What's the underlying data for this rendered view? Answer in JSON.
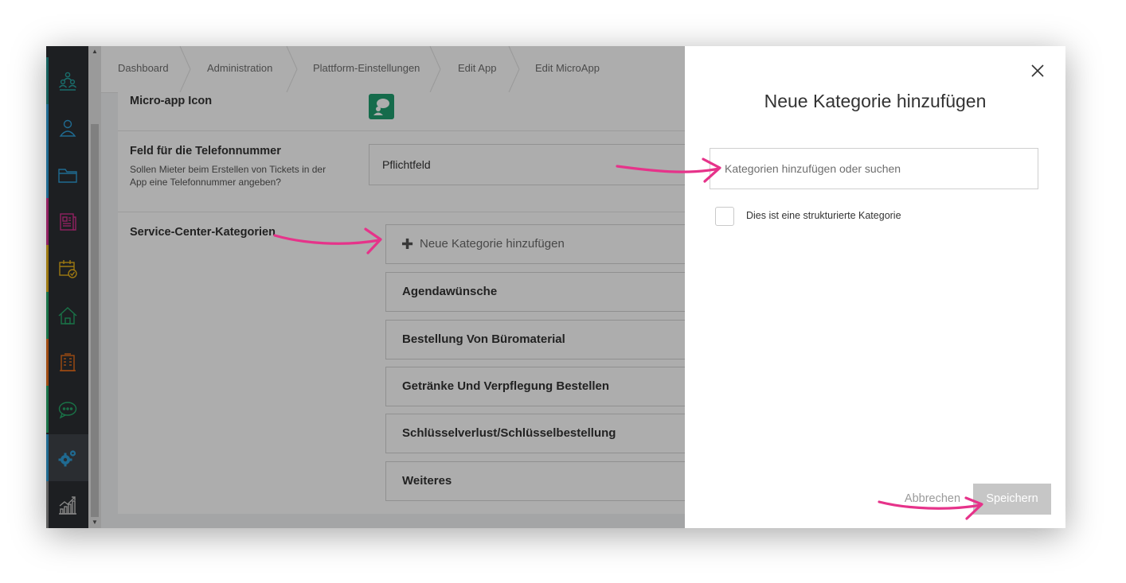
{
  "sidebar": {
    "items": [
      {
        "icon": "people-group-icon",
        "color": "#25a3a0",
        "accent": "#1f8c88"
      },
      {
        "icon": "user-icon",
        "color": "#2f9dd6",
        "accent": "#2f9dd6"
      },
      {
        "icon": "folder-icon",
        "color": "#2f9dd6",
        "accent": "#2f9dd6"
      },
      {
        "icon": "newspaper-icon",
        "color": "#d6318f",
        "accent": "#d6318f"
      },
      {
        "icon": "calendar-check-icon",
        "color": "#e8b11a",
        "accent": "#e8b11a"
      },
      {
        "icon": "home-icon",
        "color": "#26a969",
        "accent": "#26a969"
      },
      {
        "icon": "building-icon",
        "color": "#ea6f1b",
        "accent": "#ea6f1b"
      },
      {
        "icon": "chat-icon",
        "color": "#26a969",
        "accent": "#26a969"
      },
      {
        "icon": "settings-gears-icon",
        "color": "#2f9dd6",
        "accent": "#2f9dd6",
        "active": true
      },
      {
        "icon": "analytics-chart-icon",
        "color": "#c8c8c8",
        "accent": "#8c8c8c"
      }
    ]
  },
  "breadcrumb": [
    "Dashboard",
    "Administration",
    "Plattform-Einstellungen",
    "Edit App",
    "Edit MicroApp"
  ],
  "form": {
    "icon_label": "Micro-app Icon",
    "phone_label": "Feld für die Telefonnummer",
    "phone_sub_1": "Sollen Mieter beim Erstellen von Tickets in der",
    "phone_sub_2": "App eine Telefonnummer angeben?",
    "phone_value": "Pflichtfeld",
    "categories_label": "Service-Center-Kategorien",
    "add_category": "Neue Kategorie hinzufügen",
    "categories": [
      "Agendawünsche",
      "Bestellung Von Büromaterial",
      "Getränke Und Verpflegung Bestellen",
      "Schlüsselverlust/Schlüsselbestellung",
      "Weiteres"
    ]
  },
  "modal": {
    "title": "Neue Kategorie hinzufügen",
    "input_placeholder": "Kategorien hinzufügen oder suchen",
    "checkbox_label": "Dies ist eine strukturierte Kategorie",
    "cancel": "Abbrechen",
    "save": "Speichern"
  },
  "annotation_color": "#e6338a"
}
